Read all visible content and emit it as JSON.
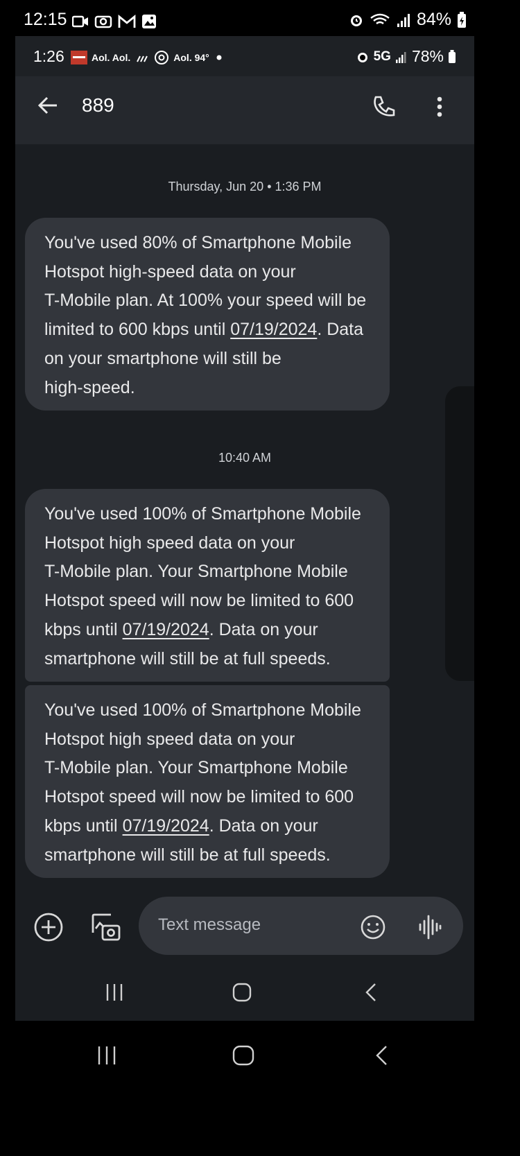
{
  "outer_status": {
    "time": "12:15",
    "battery": "84%"
  },
  "inner_status": {
    "time": "1:26",
    "mid_text": "Aol. Aol.",
    "mid_text2": "Aol. 94°",
    "network": "5G",
    "battery": "78%"
  },
  "header": {
    "title": "889"
  },
  "conversation": {
    "timestamp1": "Thursday, Jun 20 • 1:36 PM",
    "timestamp2": "10:40 AM",
    "messages": [
      {
        "lines": [
          "You've used 80% of Smartphone Mobile",
          "Hotspot high-speed data on your",
          "T-Mobile plan. At 100% your speed will be",
          "limited to 600 kbps until ",
          "07/19/2024",
          ". Data",
          "on your smartphone will still be",
          "high-speed."
        ]
      },
      {
        "lines": [
          "You've used 100% of Smartphone Mobile",
          "Hotspot high speed data on your",
          "T-Mobile plan. Your Smartphone Mobile",
          "Hotspot speed will now be limited to 600",
          "kbps until ",
          "07/19/2024",
          ". Data on your",
          "smartphone will still be at full speeds."
        ]
      },
      {
        "lines": [
          "You've used 100% of Smartphone Mobile",
          "Hotspot high speed data on your",
          "T-Mobile plan. Your Smartphone Mobile",
          "Hotspot speed will now be limited to 600",
          "kbps until ",
          "07/19/2024",
          ". Data on your",
          "smartphone will still be at full speeds."
        ]
      }
    ]
  },
  "composer": {
    "placeholder": "Text message"
  },
  "icons": [
    "back-arrow-icon",
    "phone-icon",
    "more-vert-icon",
    "add-icon",
    "gallery-icon",
    "emoji-icon",
    "voice-icon",
    "recents-icon",
    "home-icon",
    "back-icon"
  ]
}
